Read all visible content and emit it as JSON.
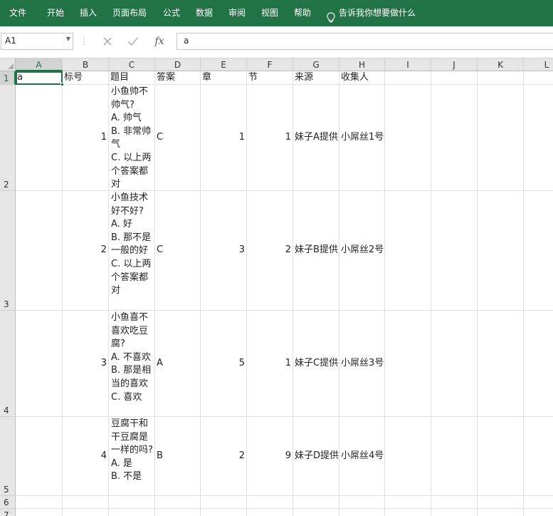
{
  "ribbon": {
    "tabs": [
      "文件",
      "开始",
      "插入",
      "页面布局",
      "公式",
      "数据",
      "审阅",
      "视图",
      "帮助"
    ],
    "tell_me": "告诉我你想要做什么"
  },
  "formula_bar": {
    "name_box": "A1",
    "formula": "a",
    "fx_label": "fx"
  },
  "columns": [
    "A",
    "B",
    "C",
    "D",
    "E",
    "F",
    "G",
    "H",
    "I",
    "J",
    "K",
    "L"
  ],
  "rows": [
    "1",
    "2",
    "3",
    "4",
    "5",
    "6",
    "7"
  ],
  "selected_cell": "A1",
  "cells": {
    "header": [
      "a",
      "标号",
      "题目",
      "答案",
      "章",
      "节",
      "来源",
      "收集人"
    ],
    "data": [
      {
        "no": "1",
        "question": "小鱼帅不帅气?\nA. 帅气\nB. 非常帅气\nC. 以上两个答案都对",
        "answer": "C",
        "chapter": "1",
        "section": "1",
        "source": "妹子A提供",
        "collector": "小屌丝1号"
      },
      {
        "no": "2",
        "question": "小鱼技术好不好?\nA. 好\nB. 那不是一般的好\nC. 以上两个答案都对",
        "answer": "C",
        "chapter": "3",
        "section": "2",
        "source": "妹子B提供",
        "collector": "小屌丝2号"
      },
      {
        "no": "3",
        "question": "小鱼喜不喜欢吃豆腐?\nA. 不喜欢\nB. 那是相当的喜欢\nC. 喜欢",
        "answer": "A",
        "chapter": "5",
        "section": "1",
        "source": "妹子C提供",
        "collector": "小屌丝3号"
      },
      {
        "no": "4",
        "question": "豆腐干和干豆腐是一样的吗?\nA. 是\nB. 不是",
        "answer": "B",
        "chapter": "2",
        "section": "9",
        "source": "妹子D提供",
        "collector": "小屌丝4号"
      }
    ]
  },
  "colors": {
    "ribbon": "#217346",
    "selection": "#217346",
    "gridline": "#e1e1e1",
    "header_bg": "#e6e6e6"
  }
}
